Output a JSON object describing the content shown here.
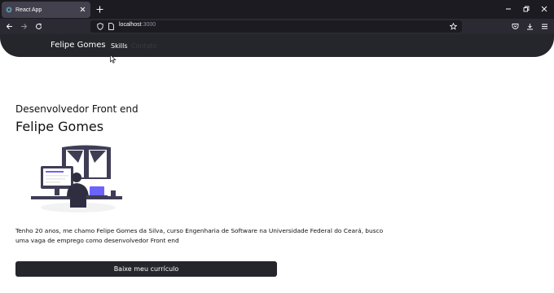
{
  "browser": {
    "tab": {
      "title": "React App",
      "favicon": "react-icon"
    },
    "url": {
      "host": "localhost",
      "port": ":3000"
    },
    "icons": [
      "back-icon",
      "forward-icon",
      "reload-icon",
      "shield-icon",
      "page-icon",
      "bookmark-star-icon",
      "pocket-icon",
      "download-icon",
      "menu-icon",
      "minimize-icon",
      "restore-icon",
      "close-icon",
      "new-tab-icon"
    ]
  },
  "header": {
    "brand": "Felipe Gomes",
    "nav": [
      "Skills",
      "Contato"
    ]
  },
  "hero": {
    "subtitle": "Desenvolvedor Front end",
    "name": "Felipe Gomes",
    "bio": "Tenho 20 anos, me chamo Felipe Gomes da Silva, curso Engenharia de Software na Universidade Federal do Ceará, busco uma vaga de emprego como desenvolvedor Front end",
    "cta": "Baixe meu currículo"
  },
  "colors": {
    "header": "#24262b",
    "browser_tabbar": "#1c1b22",
    "browser_toolbar": "#2b2a33",
    "accent_laptop": "#6c63ff"
  }
}
